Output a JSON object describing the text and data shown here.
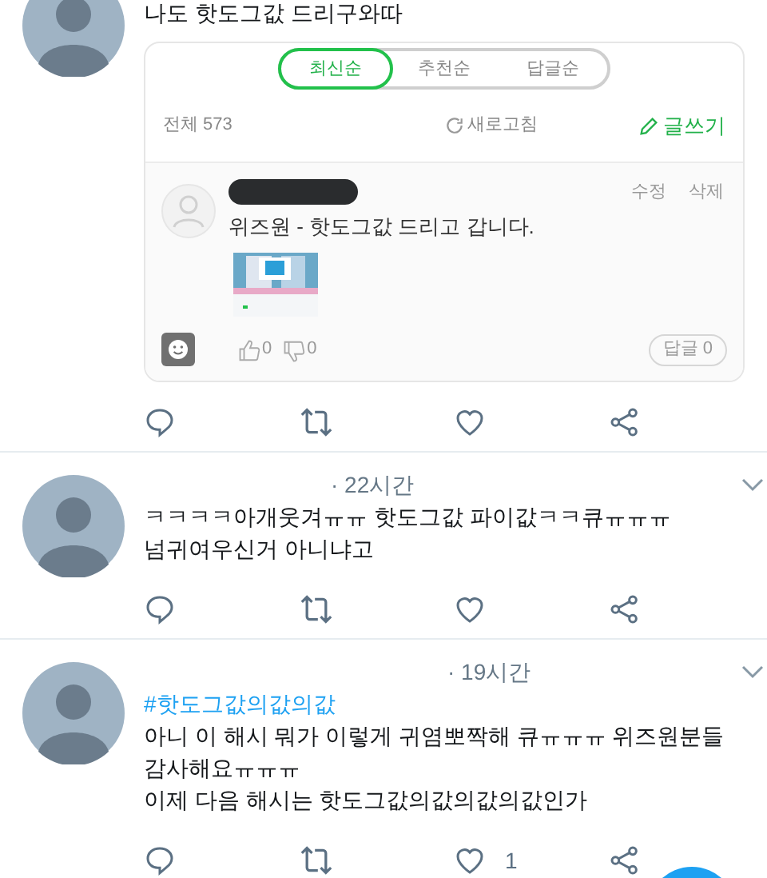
{
  "tweets": [
    {
      "lines": [
        "나도 핫도그값 드리구와따"
      ],
      "comments": {
        "tabs": [
          {
            "label": "최신순",
            "selected": true
          },
          {
            "label": "추천순",
            "selected": false
          },
          {
            "label": "답글순",
            "selected": false
          }
        ],
        "total": "전체 573",
        "refresh": "새로고침",
        "write": "글쓰기",
        "items": [
          {
            "edit": "수정",
            "delete": "삭제",
            "text": "위즈원 - 핫도그값 드리고 갑니다.",
            "likes": "0",
            "dislikes": "0",
            "replies": "답글 0"
          }
        ]
      }
    },
    {
      "time": "· 22시간",
      "lines": [
        "ㅋㅋㅋㅋ아개웃겨ㅠㅠ 핫도그값 파이값ㅋㅋ큐ㅠㅠㅠ",
        "넘귀여우신거 아니냐고"
      ]
    },
    {
      "time": "· 19시간",
      "hashtag": "#핫도그값의값의값",
      "lines": [
        "아니 이 해시 뭐가 이렇게 귀염뽀짝해 큐ㅠㅠㅠ 위즈원분들",
        "감사해요ㅠㅠㅠ",
        "이제 다음 해시는 핫도그값의값의값의값인가"
      ],
      "like_count": "1"
    }
  ]
}
